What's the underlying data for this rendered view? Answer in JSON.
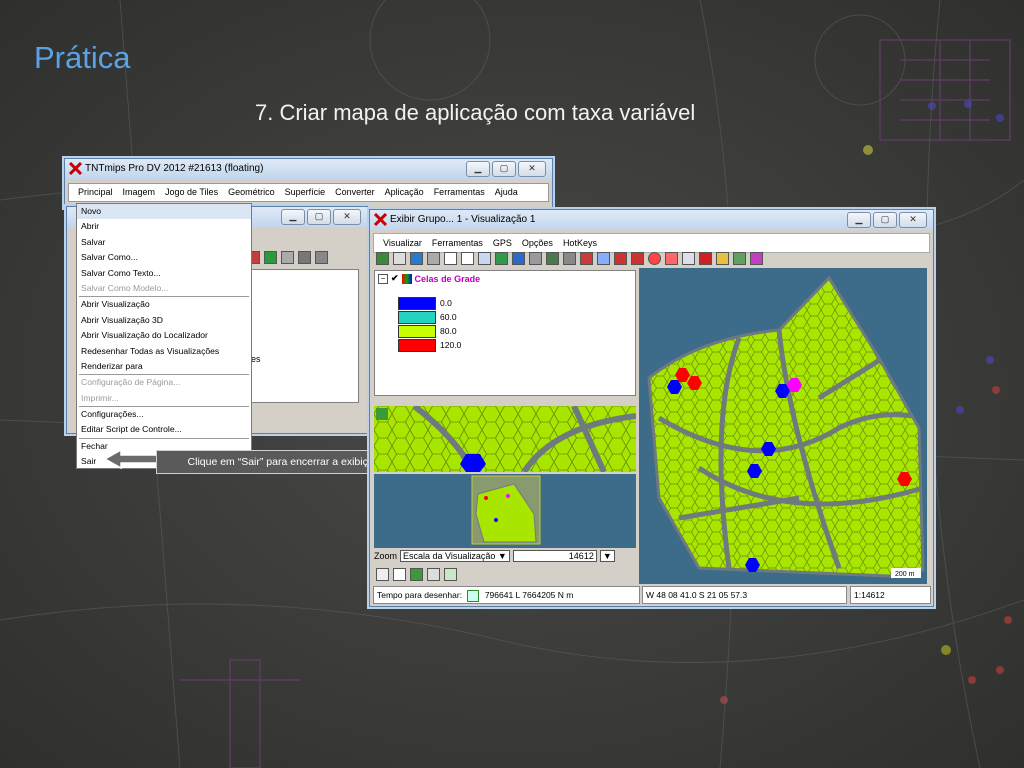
{
  "slide": {
    "title": "Prática",
    "subtitle": "7. Criar mapa de aplicação com taxa variável"
  },
  "main_window": {
    "title": "TNTmips Pro DV 2012  #21613 (floating)",
    "menu": [
      "Principal",
      "Imagem",
      "Jogo de Tiles",
      "Geométrico",
      "Superfície",
      "Converter",
      "Aplicação",
      "Ferramentas",
      "Ajuda"
    ]
  },
  "principal_menu": {
    "items": [
      {
        "label": "Novo",
        "disabled": false,
        "highlight": true
      },
      {
        "label": "Abrir",
        "disabled": false
      },
      {
        "label": "Salvar",
        "disabled": false
      },
      {
        "label": "Salvar Como...",
        "disabled": false
      },
      {
        "label": "Salvar Como Texto...",
        "disabled": false
      },
      {
        "label": "Salvar Como Modelo...",
        "disabled": true
      },
      {
        "label": "Abrir Visualização",
        "disabled": false
      },
      {
        "label": "Abrir Visualização 3D",
        "disabled": false
      },
      {
        "label": "Abrir Visualização do Localizador",
        "disabled": false
      },
      {
        "label": "Redesenhar Todas as Visualizações",
        "disabled": false
      },
      {
        "label": "Renderizar para",
        "disabled": false
      },
      {
        "label": "Configuração de Página...",
        "disabled": true
      },
      {
        "label": "Imprimir...",
        "disabled": true
      },
      {
        "label": "Configurações...",
        "disabled": false
      },
      {
        "label": "Editar Script de Controle...",
        "disabled": false
      },
      {
        "label": "Fechar",
        "disabled": false
      },
      {
        "label": "Sair",
        "disabled": false
      }
    ],
    "partial_text": "es"
  },
  "callout": "Clique em “Sair” para encerrar a exibição.",
  "view_window": {
    "title": "Exibir Grupo... 1 - Visualização 1",
    "menu": [
      "Visualizar",
      "Ferramentas",
      "GPS",
      "Opções",
      "HotKeys"
    ],
    "layer_name": "Celas de Grade",
    "legend": [
      {
        "label": "0.0",
        "color": "#0000ff"
      },
      {
        "label": "60.0",
        "color": "#22d3c0"
      },
      {
        "label": "80.0",
        "color": "#c8ff00"
      },
      {
        "label": "120.0",
        "color": "#ff0000"
      }
    ],
    "zoom_label": "Zoom",
    "scale_select": "Escala da Visualização",
    "scale_value": "14612",
    "scale_bar": "200 m",
    "status": {
      "label": "Tempo para desenhar:",
      "coords": "796641 L  7664205 N m",
      "latlon": "W 48 08 41.0  S 21 05 57.3",
      "scale": "1:14612"
    },
    "colors": {
      "map_bg": "#3d6b8a",
      "field": "#a8e600",
      "road": "#6f7a7e"
    }
  }
}
